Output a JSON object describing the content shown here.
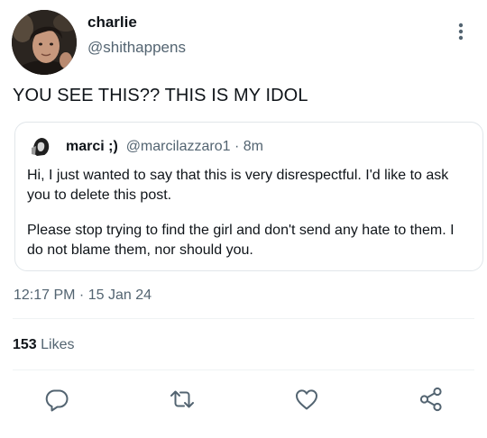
{
  "author": {
    "name": "charlie",
    "handle": "@shithappens"
  },
  "tweet": {
    "text": "YOU SEE THIS?? THIS IS MY IDOL"
  },
  "quoted": {
    "name": "marci ;)",
    "handle": "@marcilazzaro1",
    "separator": "·",
    "time": "8m",
    "paragraphs": [
      "Hi, I just wanted to say that this is very disrespectful. I'd like to ask you to delete this post.",
      "Please stop trying to find the girl and don't send any hate to them. I do not blame them, nor should you."
    ]
  },
  "meta": {
    "timestamp": "12:17 PM · 15 Jan 24"
  },
  "stats": {
    "likes_count": "153",
    "likes_label": "Likes"
  },
  "actions": [
    {
      "name": "reply",
      "icon": "reply-icon"
    },
    {
      "name": "retweet",
      "icon": "retweet-icon"
    },
    {
      "name": "like",
      "icon": "heart-icon"
    },
    {
      "name": "share",
      "icon": "share-icon"
    }
  ],
  "colors": {
    "text_primary": "#0f1419",
    "text_secondary": "#536471",
    "border": "#e1e6ea",
    "icon": "#536471"
  }
}
